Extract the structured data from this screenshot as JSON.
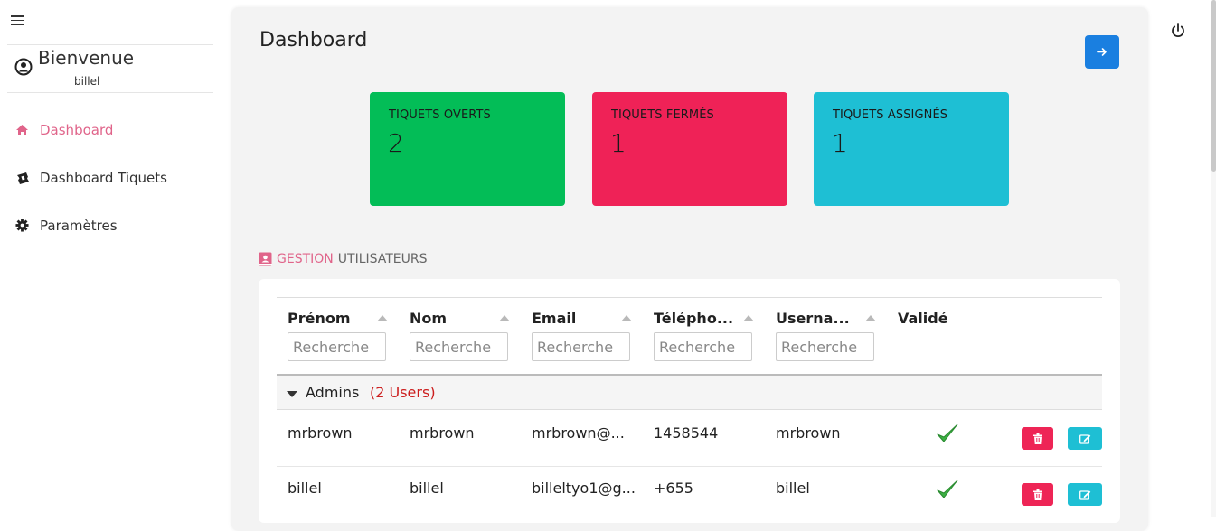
{
  "sidebar": {
    "welcome": "Bienvenue",
    "username": "billel",
    "items": [
      {
        "label": "Dashboard",
        "icon": "home-icon",
        "active": true
      },
      {
        "label": "Dashboard Tiquets",
        "icon": "ticket-icon",
        "active": false
      },
      {
        "label": "Paramètres",
        "icon": "gear-icon",
        "active": false
      }
    ]
  },
  "header": {
    "title": "Dashboard"
  },
  "cards": [
    {
      "title": "TIQUETS OVERTS",
      "value": "2",
      "color": "#03bd57"
    },
    {
      "title": "TIQUETS FERMÉS",
      "value": "1",
      "color": "#ef2257"
    },
    {
      "title": "TIQUETS ASSIGNÉS",
      "value": "1",
      "color": "#1ebfd4"
    }
  ],
  "section": {
    "highlight": "GESTION",
    "rest": "UTILISATEURS"
  },
  "table": {
    "columns": [
      "Prénom",
      "Nom",
      "Email",
      "Télépho...",
      "Userna...",
      "Validé"
    ],
    "filter_placeholder": "Recherche",
    "group": {
      "label": "Admins",
      "count": "(2 Users)"
    },
    "rows": [
      {
        "prenom": "mrbrown",
        "nom": "mrbrown",
        "email": "mrbrown@...",
        "telephone": "1458544",
        "username": "mrbrown",
        "valide": true
      },
      {
        "prenom": "billel",
        "nom": "billel",
        "email": "billeltyo1@g...",
        "telephone": "+655",
        "username": "billel",
        "valide": true
      }
    ]
  },
  "colors": {
    "accent": "#e0648a",
    "primary": "#1a7fe0",
    "danger": "#ee2556",
    "info": "#1ebfd4",
    "success": "#3cb043"
  }
}
